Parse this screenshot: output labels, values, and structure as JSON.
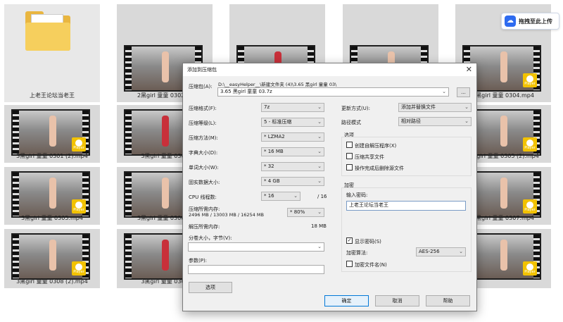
{
  "desktop": {
    "folder_label": "上老王论坛当老王",
    "player_badge": "Player",
    "items": [
      "上老王论坛当老王",
      "2黑girl 童童 0302 (2",
      "",
      "",
      "2黑girl 童童 0304.mp4",
      "3黑girl 童童 0301 (2).mp4",
      "3黑girl 童童 0301",
      "",
      "",
      "3黑girl 童童 0305 (2).mp4",
      "3黑girl 童童 0305.mp4",
      "3黑girl 童童 0306 (2",
      "",
      "",
      "3黑girl 童童 0307.mp4",
      "3黑girl 童童 0308 (2).mp4",
      "3黑girl 童童 0308",
      "",
      "",
      ""
    ]
  },
  "upload_button": {
    "label": "拖拽至此上传"
  },
  "dialog": {
    "title": "添加到压缩包",
    "archive_label": "压缩包(A):",
    "archive_dir": "D:\\__easyHelper__\\新建文件夹 (4)\\3.65 黑girl 童童 03\\",
    "archive_name": "3.65 黑girl 童童 03.7z",
    "browse_label": "...",
    "format_label": "压缩格式(F):",
    "format_value": "7z",
    "level_label": "压缩等级(L):",
    "level_value": "5 - 标准压缩",
    "method_label": "压缩方法(M):",
    "method_value": "* LZMA2",
    "dict_label": "字典大小(D):",
    "dict_value": "* 16 MB",
    "word_label": "单词大小(W):",
    "word_value": "* 32",
    "solid_label": "固实数据大小:",
    "solid_value": "* 4 GB",
    "threads_label": "CPU 线程数:",
    "threads_value": "* 16",
    "threads_total": "/ 16",
    "mem_compress_label": "压缩所需内存:",
    "mem_compress_value": "2496 MB / 13003 MB / 16254 MB",
    "mem_percent": "* 80%",
    "mem_decompress_label": "解压所需内存:",
    "mem_decompress_value": "18 MB",
    "split_label": "分卷大小，字节(V):",
    "split_value": "",
    "params_label": "参数(P):",
    "params_value": "",
    "options_button": "选项",
    "update_label": "更新方式(U):",
    "update_value": "添加并替换文件",
    "path_label": "路径模式",
    "path_value": "相对路径",
    "options_group": "选项",
    "opt_sfx": "创建自解压程序(X)",
    "opt_shared": "压缩共享文件",
    "opt_delete": "操作完成后删除源文件",
    "encrypt_group": "加密",
    "password_label": "输入密码:",
    "password_value": "上老王论坛当老王",
    "show_password": "显示密码(S)",
    "enc_method_label": "加密算法:",
    "enc_method_value": "AES-256",
    "encrypt_names": "加密文件名(N)",
    "ok_label": "确定",
    "cancel_label": "取消",
    "help_label": "帮助"
  }
}
